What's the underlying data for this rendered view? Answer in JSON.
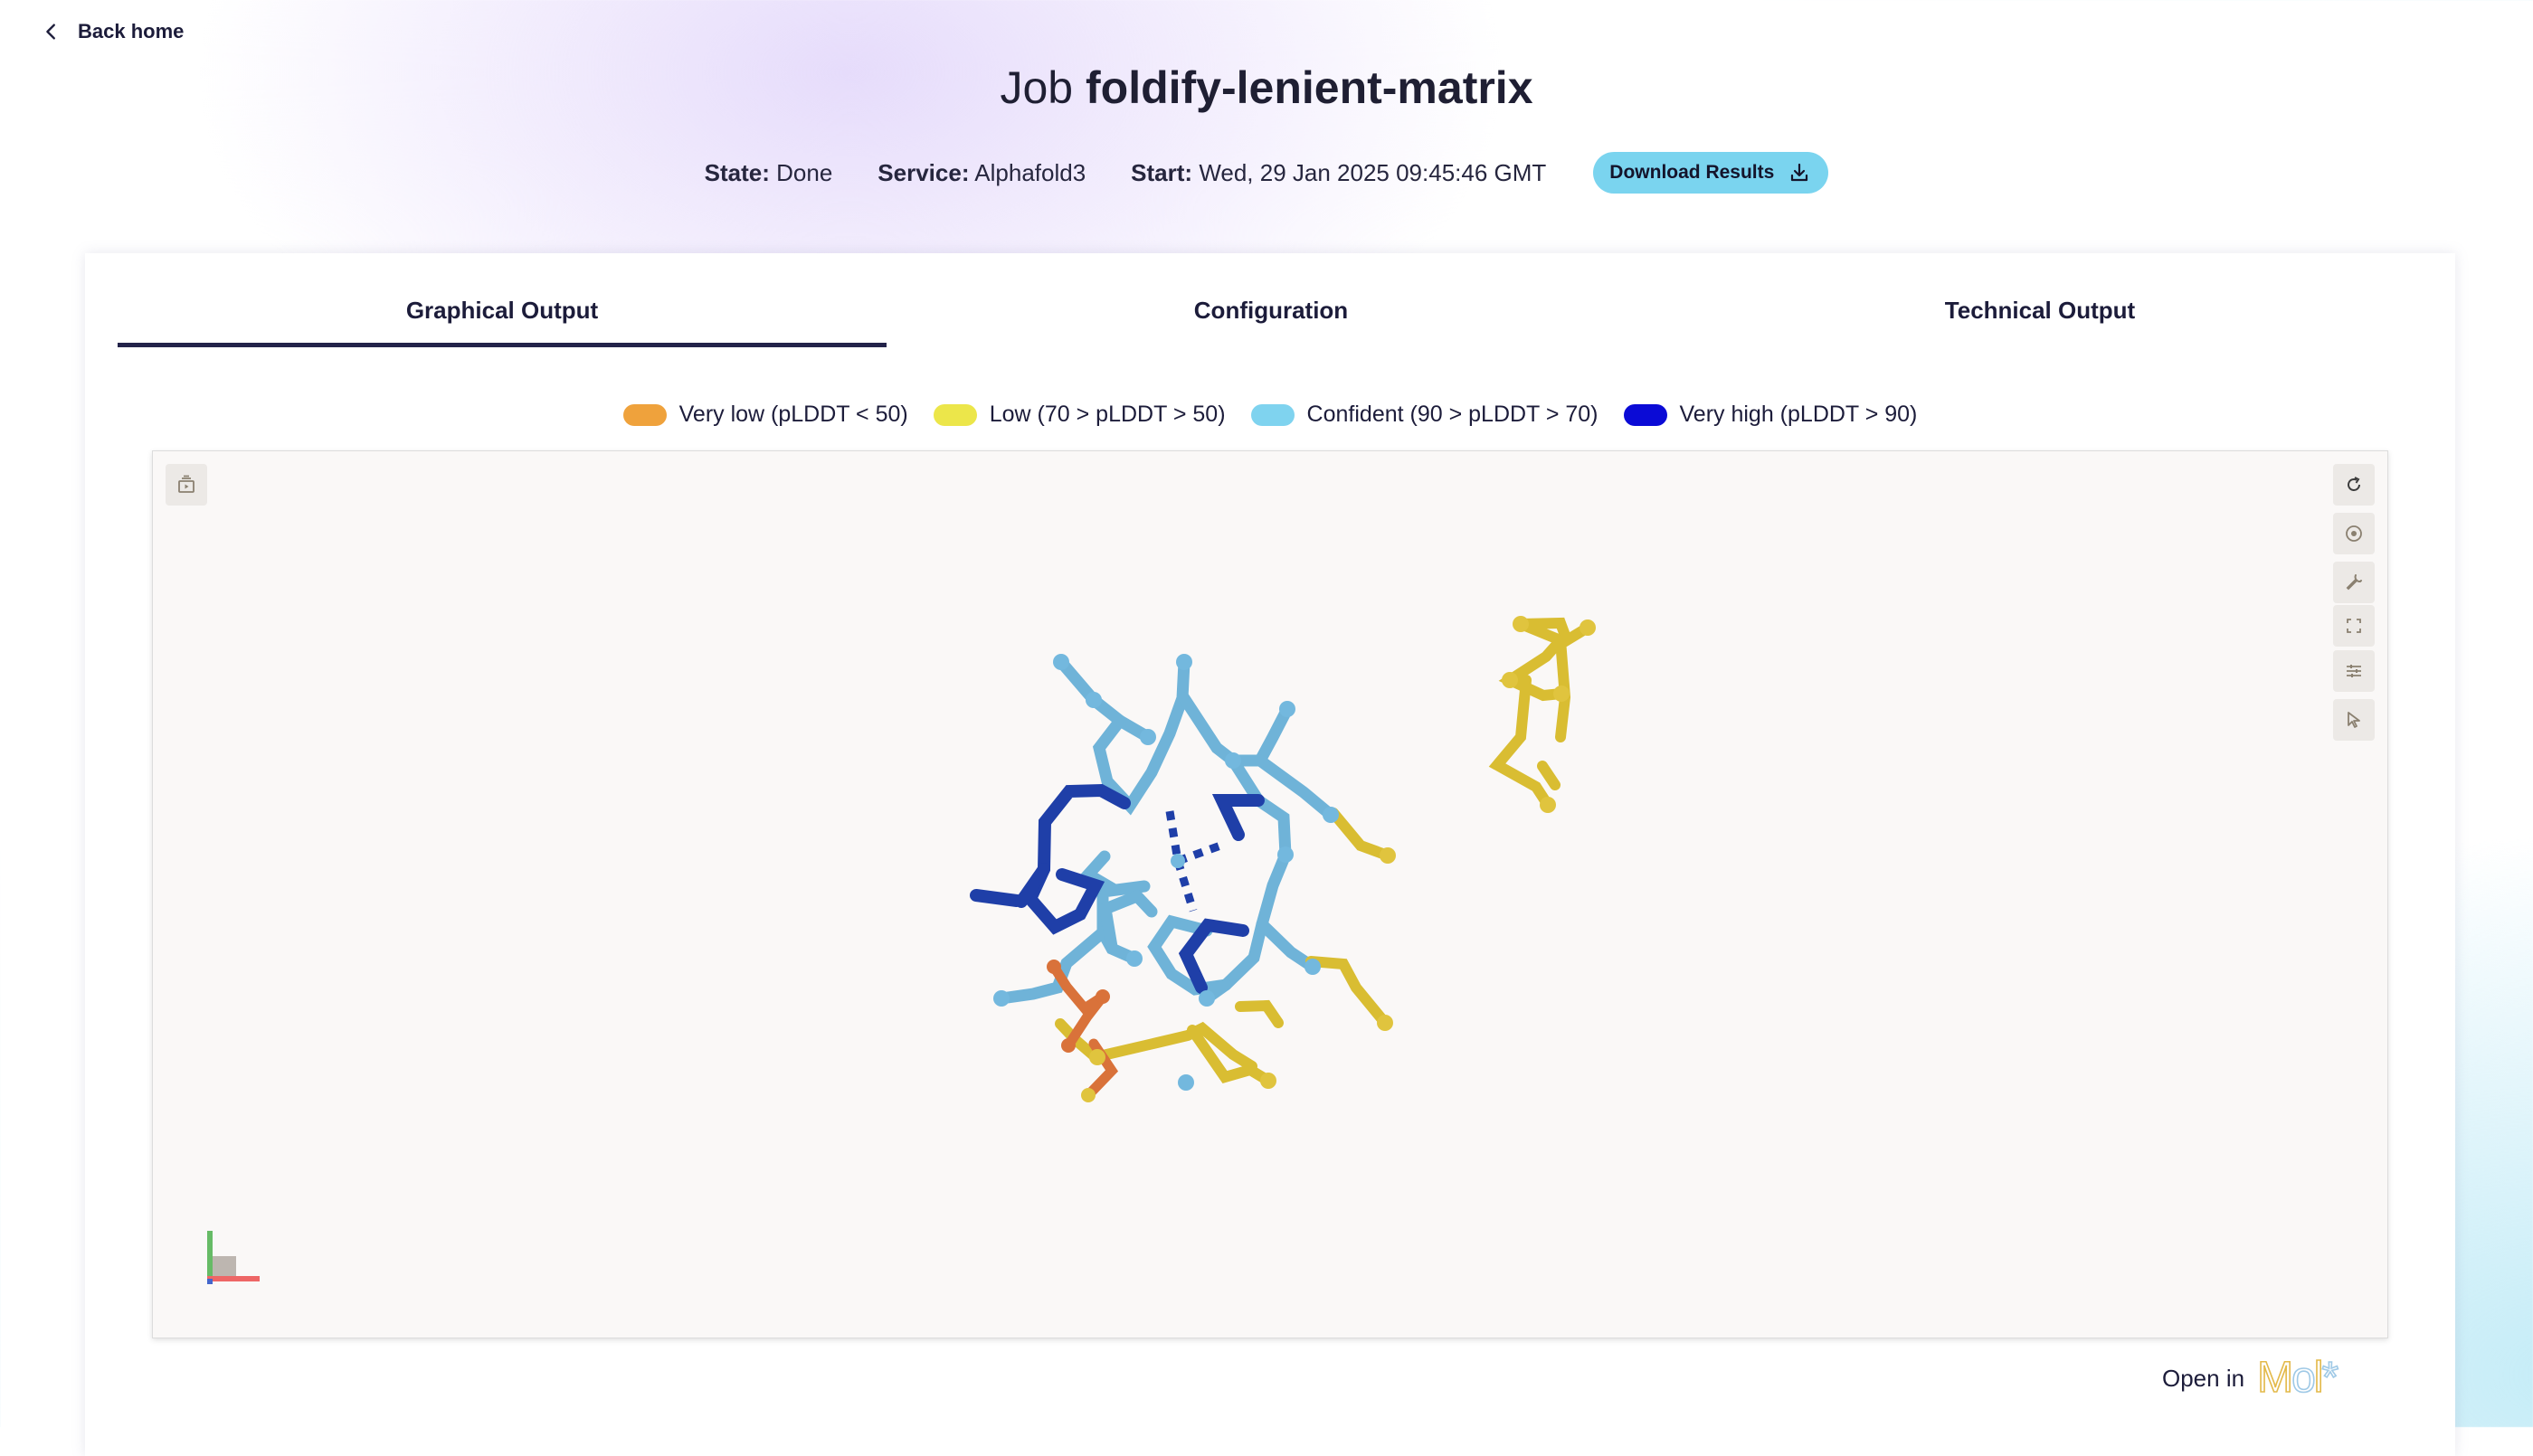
{
  "nav": {
    "back_label": "Back home",
    "back_icon": "chevron-left-icon"
  },
  "job": {
    "title_prefix": "Job",
    "name": "foldify-lenient-matrix"
  },
  "meta": {
    "state_label": "State:",
    "state_value": "Done",
    "service_label": "Service:",
    "service_value": "Alphafold3",
    "start_label": "Start:",
    "start_value": "Wed, 29 Jan 2025 09:45:46 GMT"
  },
  "download": {
    "label": "Download Results",
    "icon": "download-icon",
    "color": "#7ad4ef"
  },
  "tabs": [
    {
      "label": "Graphical Output",
      "active": true
    },
    {
      "label": "Configuration",
      "active": false
    },
    {
      "label": "Technical Output",
      "active": false
    }
  ],
  "legend": [
    {
      "label": "Very low (pLDDT < 50)",
      "color": "#efa23c"
    },
    {
      "label": "Low (70 > pLDDT > 50)",
      "color": "#ece64a"
    },
    {
      "label": "Confident (90 > pLDDT > 70)",
      "color": "#7fd3ef"
    },
    {
      "label": "Very high (pLDDT > 90)",
      "color": "#0b0bd6"
    }
  ],
  "viewer": {
    "left_tool_icon": "snapshot-icon",
    "right_tools": [
      "reset-view-icon",
      "screenshot-icon",
      "wrench-icon",
      "fullscreen-icon",
      "settings-sliders-icon",
      "select-cursor-icon"
    ]
  },
  "open_in": {
    "label": "Open in",
    "logo_text": "Mol*"
  }
}
